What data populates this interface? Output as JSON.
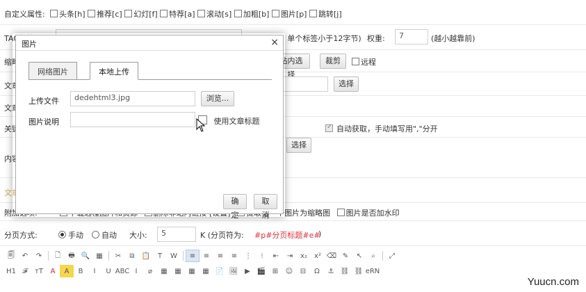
{
  "form": {
    "custom_attr_label": "自定义属性:",
    "custom_attrs": [
      "头条[h]",
      "推荐[c]",
      "幻灯[f]",
      "特荐[a]",
      "滚动[s]",
      "加粗[b]",
      "图片[p]",
      "跳转[j]"
    ],
    "tag_label": "TAG标签:",
    "tag_hint": "(',' 号分开，单个标签小于12字节)",
    "weight_label": "权重:",
    "weight_value": "7",
    "weight_hint": "(越小越靠前)",
    "thumb_label": "缩略图:",
    "thumb_inner_select": "站内选择",
    "crop_label": "裁剪",
    "remote_label": "远程",
    "source_label": "文章来源:",
    "source_select": "选择",
    "author_label": "文章作者:",
    "keywords_label": "关键字:",
    "auto_fetch_label": "自动获取，手动填写用\",\"分开",
    "desc_label": "内容摘要:",
    "desc_select": "选择",
    "content_label": "文章内容",
    "extra_label": "附加选项:",
    "extra_options": [
      "下载远程图片和资源",
      "删除非站内链接 [设置]",
      "提取第一个图片为缩略图",
      "图片是否加水印"
    ],
    "paging_label": "分页方式:",
    "paging_manual": "手动",
    "paging_auto": "自动",
    "size_label": "大小:",
    "size_value": "5",
    "size_unit": "K (分页符为:",
    "page_token": "#p#分页标题#e#",
    "page_token_close": ")"
  },
  "toolbar": {
    "row1": [
      "source-icon",
      "undo-icon",
      "redo-icon",
      "sep",
      "new-doc-icon",
      "print-icon",
      "preview-icon",
      "template-icon",
      "sep",
      "cut-icon",
      "copy-icon",
      "paste-icon",
      "paste-text-icon",
      "paste-word-icon",
      "sep",
      "align-left-icon",
      "align-center-icon",
      "align-right-icon",
      "align-justify-icon",
      "ordered-list-icon",
      "unordered-list-icon",
      "outdent-icon",
      "indent-icon",
      "subscript-icon",
      "superscript-icon",
      "clear-format-icon",
      "spellcheck-icon",
      "select-all-icon",
      "find-replace-icon",
      "sep",
      "maximize-icon"
    ],
    "row1_glyphs": [
      "🗐",
      "↶",
      "↷",
      "",
      "🗋",
      "🖶",
      "🔍",
      "▦",
      "",
      "✂",
      "⧉",
      "📋",
      "T",
      "W",
      "",
      "≡",
      "≡",
      "≡",
      "≡",
      "⋮",
      "⁝",
      "⇤",
      "⇥",
      "x₂",
      "x²",
      "⌫",
      "✎",
      "↖",
      "⌕",
      "",
      "⤢"
    ],
    "row2_labels": [
      "H1",
      "𝓕",
      "тT",
      "A",
      "A",
      "B",
      "I",
      "U",
      "ABC",
      "I",
      "⌀",
      "▦",
      "▦",
      "▦",
      "▦",
      "📄",
      "🖼",
      "▶",
      "🎬",
      "⊞",
      "☺",
      "⊟",
      "Ω",
      "⚓",
      "⛓",
      "⛓",
      "eRN"
    ],
    "row2_names": [
      "heading-icon",
      "font-family-icon",
      "font-size-icon",
      "font-color-icon",
      "highlight-icon",
      "bold-icon",
      "italic-icon",
      "underline-icon",
      "strikethrough-icon",
      "italic-clear-icon",
      "eraser-icon",
      "table-icon",
      "image-icon",
      "flash-icon",
      "media-icon",
      "file-icon",
      "gallery-icon",
      "video-icon",
      "movie-icon",
      "code-icon",
      "emoticon-icon",
      "hr-icon",
      "special-char-icon",
      "anchor-icon",
      "link-icon",
      "unlink-icon",
      "page-break-icon"
    ]
  },
  "dialog": {
    "title": "图片",
    "close": "×",
    "tab_web": "网络图片",
    "tab_local": "本地上传",
    "upload_label": "上传文件",
    "upload_value": "dedehtml3.jpg",
    "browse_label": "浏览...",
    "caption_label": "图片说明",
    "caption_value": "",
    "use_title_label": "使用文章标题",
    "ok_label": "确定",
    "cancel_label": "取消"
  },
  "watermark": "Yuucn.com",
  "colors": {
    "accent_red": "#e0303b",
    "tab_border": "#999999"
  }
}
